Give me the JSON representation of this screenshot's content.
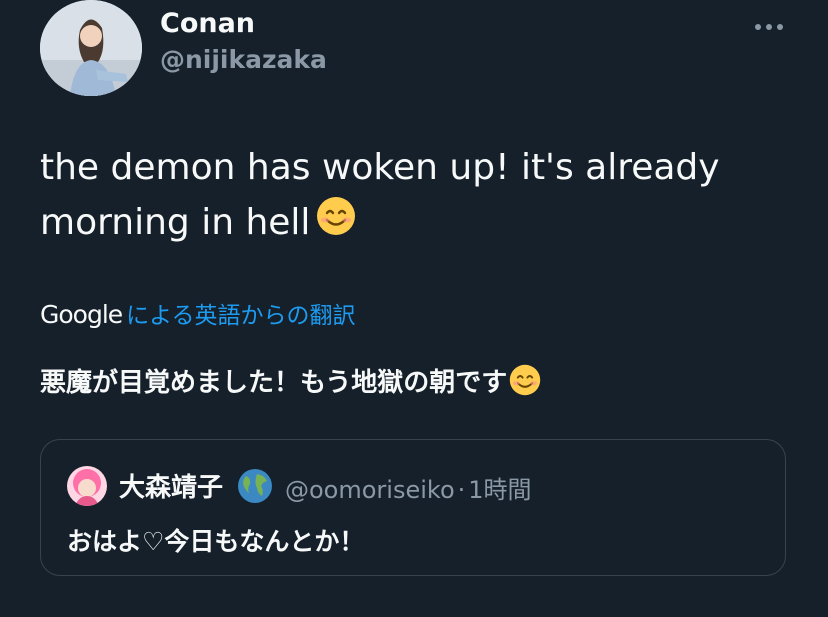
{
  "tweet": {
    "author_name": "Conan",
    "author_handle": "@nijikazaka",
    "text": "the demon has woken up! it's already morning in hell",
    "text_emoji": "smiling-face-emoji",
    "more_icon": "more-horizontal-icon"
  },
  "translation": {
    "brand": "Google",
    "link_label": "による英語からの翻訳",
    "text": "悪魔が目覚めました！もう地獄の朝です",
    "text_emoji": "smiling-face-emoji"
  },
  "quote": {
    "author_name": "大森靖子",
    "name_emoji": "globe-emoji",
    "author_handle": "@oomoriseiko",
    "separator": "·",
    "time": "1時間",
    "text": "おはよ♡今日もなんとか！"
  },
  "colors": {
    "background": "#15202b",
    "text_primary": "#f7f9f9",
    "text_secondary": "#8b98a5",
    "link": "#1d9bf0",
    "border": "#38444d"
  }
}
